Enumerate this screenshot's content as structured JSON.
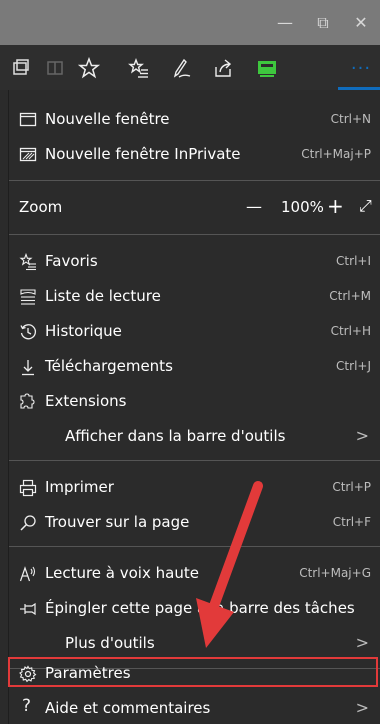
{
  "window": {
    "minimize": "—",
    "restore": "⧉",
    "close": "✕"
  },
  "toolbar": {
    "icons": [
      "tab-preview-icon",
      "reading-view-icon",
      "favorite-star-icon",
      "favorites-hub-icon",
      "notes-pen-icon",
      "share-icon",
      "extension-badge-icon",
      "more-dots-icon"
    ],
    "more": "···"
  },
  "menu": {
    "new_window": "Nouvelle fenêtre",
    "new_window_sc": "Ctrl+N",
    "new_private": "Nouvelle fenêtre InPrivate",
    "new_private_sc": "Ctrl+Maj+P",
    "zoom_label": "Zoom",
    "zoom_minus": "—",
    "zoom_value": "100%",
    "zoom_plus": "+",
    "zoom_full": "⤢",
    "favorites": "Favoris",
    "favorites_sc": "Ctrl+I",
    "reading_list": "Liste de lecture",
    "reading_list_sc": "Ctrl+M",
    "history": "Historique",
    "history_sc": "Ctrl+H",
    "downloads": "Téléchargements",
    "downloads_sc": "Ctrl+J",
    "extensions": "Extensions",
    "show_in_toolbar": "Afficher dans la barre d'outils",
    "print": "Imprimer",
    "print_sc": "Ctrl+P",
    "find": "Trouver sur la page",
    "find_sc": "Ctrl+F",
    "read_aloud": "Lecture à voix haute",
    "read_aloud_sc": "Ctrl+Maj+G",
    "pin_taskbar": "Épingler cette page à la barre des tâches",
    "more_tools": "Plus d'outils",
    "settings": "Paramètres",
    "help": "Aide et commentaires",
    "chevron": ">"
  },
  "colors": {
    "accent": "#0f6cbd",
    "annotation": "#e23a3a",
    "badge": "#3ec73e"
  }
}
